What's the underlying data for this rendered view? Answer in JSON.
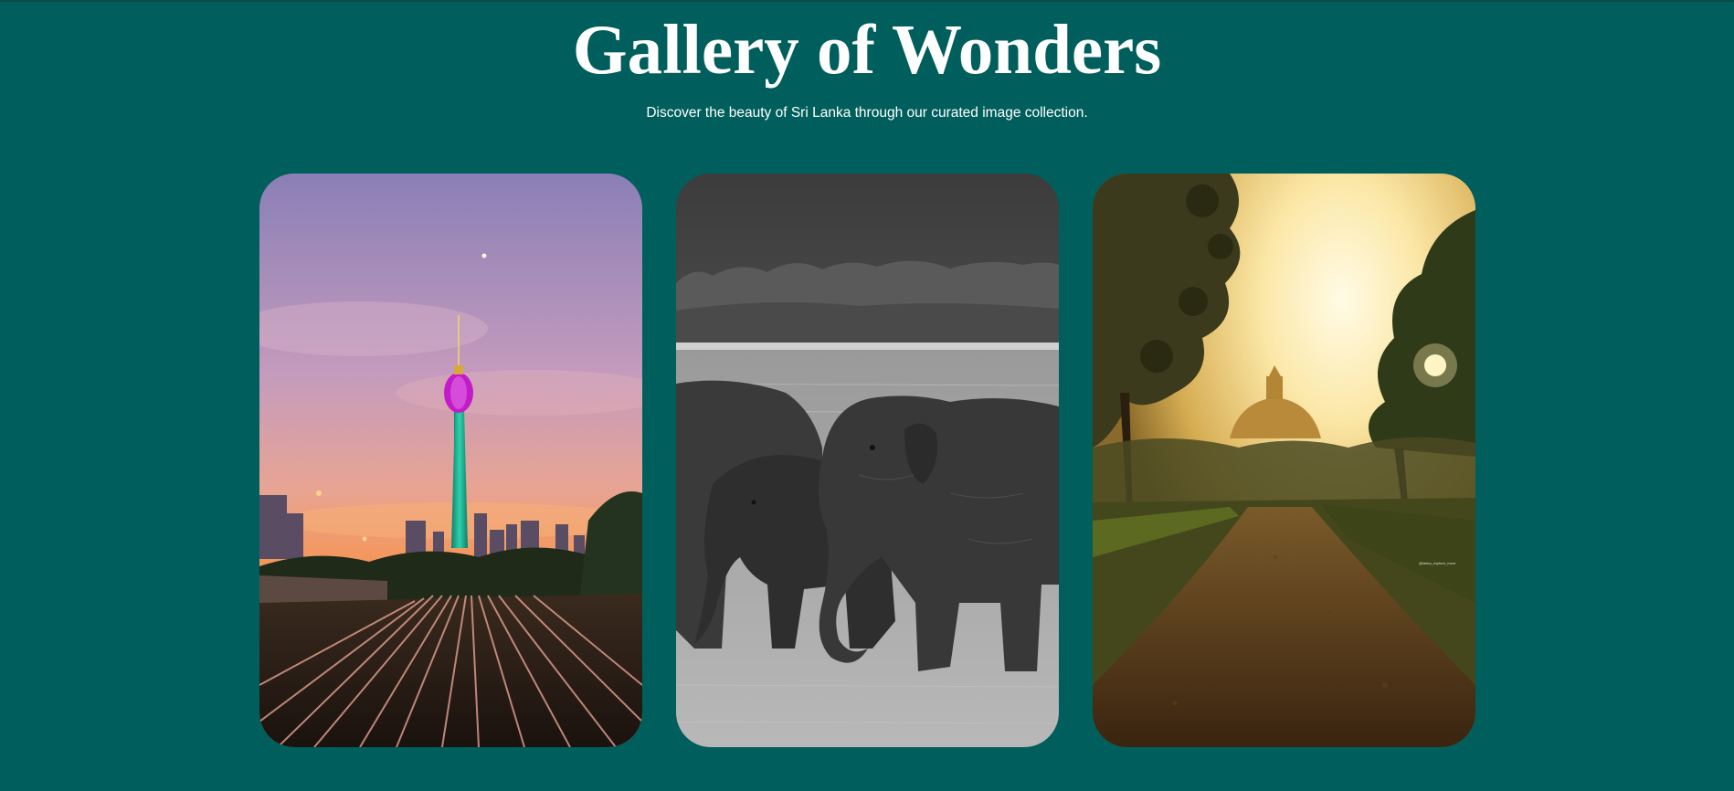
{
  "header": {
    "title": "Gallery of Wonders",
    "subtitle": "Discover the beauty of Sri Lanka through our curated image collection."
  },
  "gallery": {
    "images": [
      {
        "subject": "colombo-lotus-tower-sunset-railway",
        "palette": [
          "#a68fbf",
          "#f59b57",
          "#1fa58c",
          "#c21cc8"
        ]
      },
      {
        "subject": "elephants-grassland-monochrome",
        "palette": [
          "#4a4a4a",
          "#9c9c9c",
          "#2e2e2e"
        ]
      },
      {
        "subject": "stupa-forest-path-golden-haze",
        "palette": [
          "#fff3c4",
          "#c99a3c",
          "#3e2b10"
        ]
      }
    ],
    "photo_credit": "@lanka_explore_more"
  },
  "colors": {
    "background": "#005f5c",
    "text": "#ffffff"
  }
}
